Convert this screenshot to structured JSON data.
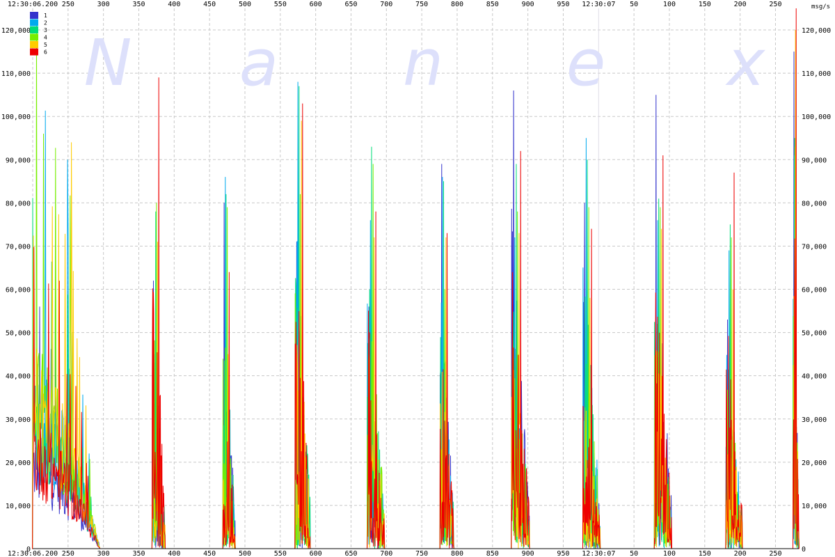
{
  "chart_data": {
    "type": "line",
    "title": "",
    "watermark": [
      "N",
      "a",
      "n",
      "e",
      "x"
    ],
    "unit_label": "msg/s",
    "xlabel": "",
    "ylabel": "",
    "x_range_ms": [
      200,
      1283
    ],
    "ylim": [
      0,
      125000
    ],
    "y_ticks": [
      0,
      10000,
      20000,
      30000,
      40000,
      50000,
      60000,
      70000,
      80000,
      90000,
      100000,
      110000,
      120000
    ],
    "y_tick_labels": [
      "0",
      "10,000",
      "20,000",
      "30,000",
      "40,000",
      "50,000",
      "60,000",
      "70,000",
      "80,000",
      "90,000",
      "100,000",
      "110,000",
      "120,000"
    ],
    "x_ticks": [
      {
        "ms": 200,
        "label": "12:30:06.200"
      },
      {
        "ms": 250,
        "label": "250"
      },
      {
        "ms": 300,
        "label": "300"
      },
      {
        "ms": 350,
        "label": "350"
      },
      {
        "ms": 400,
        "label": "400"
      },
      {
        "ms": 450,
        "label": "450"
      },
      {
        "ms": 500,
        "label": "500"
      },
      {
        "ms": 550,
        "label": "550"
      },
      {
        "ms": 600,
        "label": "600"
      },
      {
        "ms": 650,
        "label": "650"
      },
      {
        "ms": 700,
        "label": "700"
      },
      {
        "ms": 750,
        "label": "750"
      },
      {
        "ms": 800,
        "label": "800"
      },
      {
        "ms": 850,
        "label": "850"
      },
      {
        "ms": 900,
        "label": "900"
      },
      {
        "ms": 950,
        "label": "950"
      },
      {
        "ms": 1000,
        "label": "12:30:07"
      },
      {
        "ms": 1050,
        "label": "50"
      },
      {
        "ms": 1100,
        "label": "100"
      },
      {
        "ms": 1150,
        "label": "150"
      },
      {
        "ms": 1200,
        "label": "200"
      },
      {
        "ms": 1250,
        "label": "250"
      }
    ],
    "grid": true,
    "legend_position": "top-left",
    "series": [
      {
        "name": "1",
        "color": "#3333cc"
      },
      {
        "name": "2",
        "color": "#00aaee"
      },
      {
        "name": "3",
        "color": "#00dd77"
      },
      {
        "name": "4",
        "color": "#77ee00"
      },
      {
        "name": "5",
        "color": "#ffcc00"
      },
      {
        "name": "6",
        "color": "#ee0000"
      }
    ],
    "bursts": [
      {
        "x_ms": [
          200,
          295
        ],
        "peak": [
          56000,
          90000,
          77000,
          96000,
          94000,
          62000
        ],
        "dense": true
      },
      {
        "x_ms": [
          369,
          387
        ],
        "peak": [
          62000,
          45000,
          78000,
          80000,
          71000,
          109000
        ]
      },
      {
        "x_ms": [
          469,
          486
        ],
        "peak": [
          80000,
          86000,
          82000,
          79000,
          45000,
          64000
        ]
      },
      {
        "x_ms": [
          571,
          592
        ],
        "peak": [
          71000,
          108000,
          107000,
          82000,
          99000,
          103000
        ]
      },
      {
        "x_ms": [
          673,
          697
        ],
        "peak": [
          56000,
          76000,
          93000,
          89000,
          72000,
          78000
        ]
      },
      {
        "x_ms": [
          776,
          795
        ],
        "peak": [
          89000,
          86000,
          85000,
          60000,
          72000,
          73000
        ]
      },
      {
        "x_ms": [
          877,
          902
        ],
        "peak": [
          106000,
          72000,
          89000,
          78000,
          73000,
          92000
        ]
      },
      {
        "x_ms": [
          978,
          1002
        ],
        "peak": [
          80000,
          95000,
          90000,
          79000,
          58000,
          74000
        ]
      },
      {
        "x_ms": [
          1079,
          1103
        ],
        "peak": [
          105000,
          76000,
          81000,
          79000,
          74000,
          91000
        ]
      },
      {
        "x_ms": [
          1180,
          1203
        ],
        "peak": [
          53000,
          69000,
          75000,
          72000,
          60000,
          87000
        ]
      },
      {
        "x_ms": [
          1275,
          1283
        ],
        "peak": [
          115000,
          91000,
          95000,
          93000,
          120000,
          125000
        ]
      }
    ]
  }
}
